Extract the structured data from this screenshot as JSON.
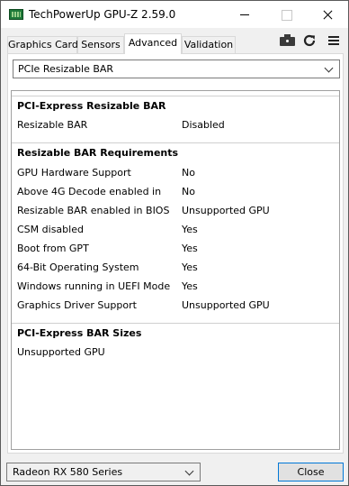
{
  "window": {
    "title": "TechPowerUp GPU-Z 2.59.0"
  },
  "tabs": [
    {
      "label": "Graphics Card"
    },
    {
      "label": "Sensors"
    },
    {
      "label": "Advanced"
    },
    {
      "label": "Validation"
    }
  ],
  "active_tab": "Advanced",
  "section_select": {
    "value": "PCIe Resizable BAR"
  },
  "sections": {
    "pcie_resizable_bar": {
      "heading": "PCI-Express Resizable BAR",
      "rows": [
        {
          "key": "Resizable BAR",
          "value": "Disabled"
        }
      ]
    },
    "requirements": {
      "heading": "Resizable BAR Requirements",
      "rows": [
        {
          "key": "GPU Hardware Support",
          "value": "No"
        },
        {
          "key": "Above 4G Decode enabled in",
          "value": "No"
        },
        {
          "key": "Resizable BAR enabled in BIOS",
          "value": "Unsupported GPU"
        },
        {
          "key": "CSM disabled",
          "value": "Yes"
        },
        {
          "key": "Boot from GPT",
          "value": "Yes"
        },
        {
          "key": "64-Bit Operating System",
          "value": "Yes"
        },
        {
          "key": "Windows running in UEFI Mode",
          "value": "Yes"
        },
        {
          "key": "Graphics Driver Support",
          "value": "Unsupported GPU"
        }
      ]
    },
    "bar_sizes": {
      "heading": "PCI-Express BAR Sizes",
      "text": "Unsupported GPU"
    }
  },
  "footer": {
    "gpu_select": "Radeon RX 580 Series",
    "close_label": "Close"
  },
  "icons": {
    "app": "gpu-z-app-icon",
    "camera": "camera-icon",
    "refresh": "refresh-icon",
    "menu": "hamburger-menu-icon"
  }
}
